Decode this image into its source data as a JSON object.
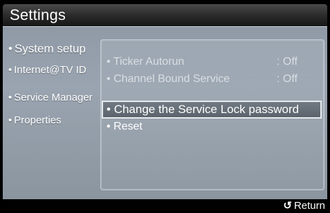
{
  "header": {
    "title": "Settings"
  },
  "sidebar": {
    "bullet": "•",
    "items": [
      {
        "label": "System setup"
      },
      {
        "label": "Internet@TV ID"
      },
      {
        "label": "Service Manager"
      },
      {
        "label": "Properties"
      }
    ]
  },
  "content": {
    "bullet": "•",
    "rows": [
      {
        "label": "Ticker Autorun",
        "value": ": Off"
      },
      {
        "label": "Channel Bound Service",
        "value": ": Off"
      },
      {
        "label": "Change the Service Lock password",
        "value": ""
      },
      {
        "label": "Reset",
        "value": ""
      }
    ]
  },
  "footer": {
    "return_icon": "↺",
    "return_label": "Return"
  },
  "colors": {
    "title_bar": "#2e2e2e",
    "panel": "#9aa4b0",
    "selected_row": "#6a737c",
    "text": "#ffffff"
  },
  "icons": {
    "return": "return-arrow-icon"
  }
}
